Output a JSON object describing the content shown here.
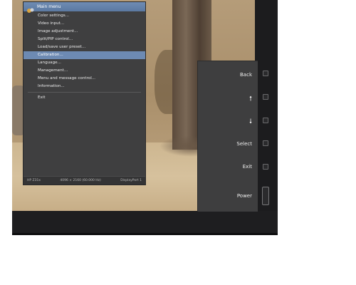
{
  "osd": {
    "title": "Main menu",
    "items": [
      {
        "label": "Color settings..."
      },
      {
        "label": "Video input..."
      },
      {
        "label": "Image adjustment..."
      },
      {
        "label": "Split/PIP control..."
      },
      {
        "label": "Load/save user preset..."
      },
      {
        "label": "Calibration...",
        "selected": true
      },
      {
        "label": "Language..."
      },
      {
        "label": "Management..."
      },
      {
        "label": "Menu and message control..."
      },
      {
        "label": "Information..."
      }
    ],
    "exit_label": "Exit",
    "footer": {
      "model": "HP Z31x",
      "resolution": "4096 × 2160 (60.000 Hz)",
      "input": "DisplayPort 1"
    }
  },
  "buttons": {
    "back": "Back",
    "up_icon": "arrow-up-icon",
    "down_icon": "arrow-down-icon",
    "select": "Select",
    "exit": "Exit",
    "power": "Power"
  },
  "colors": {
    "menu_bg": "#3f3f40",
    "highlight": "#6d8ab3",
    "bezel": "#1c1c1e"
  }
}
